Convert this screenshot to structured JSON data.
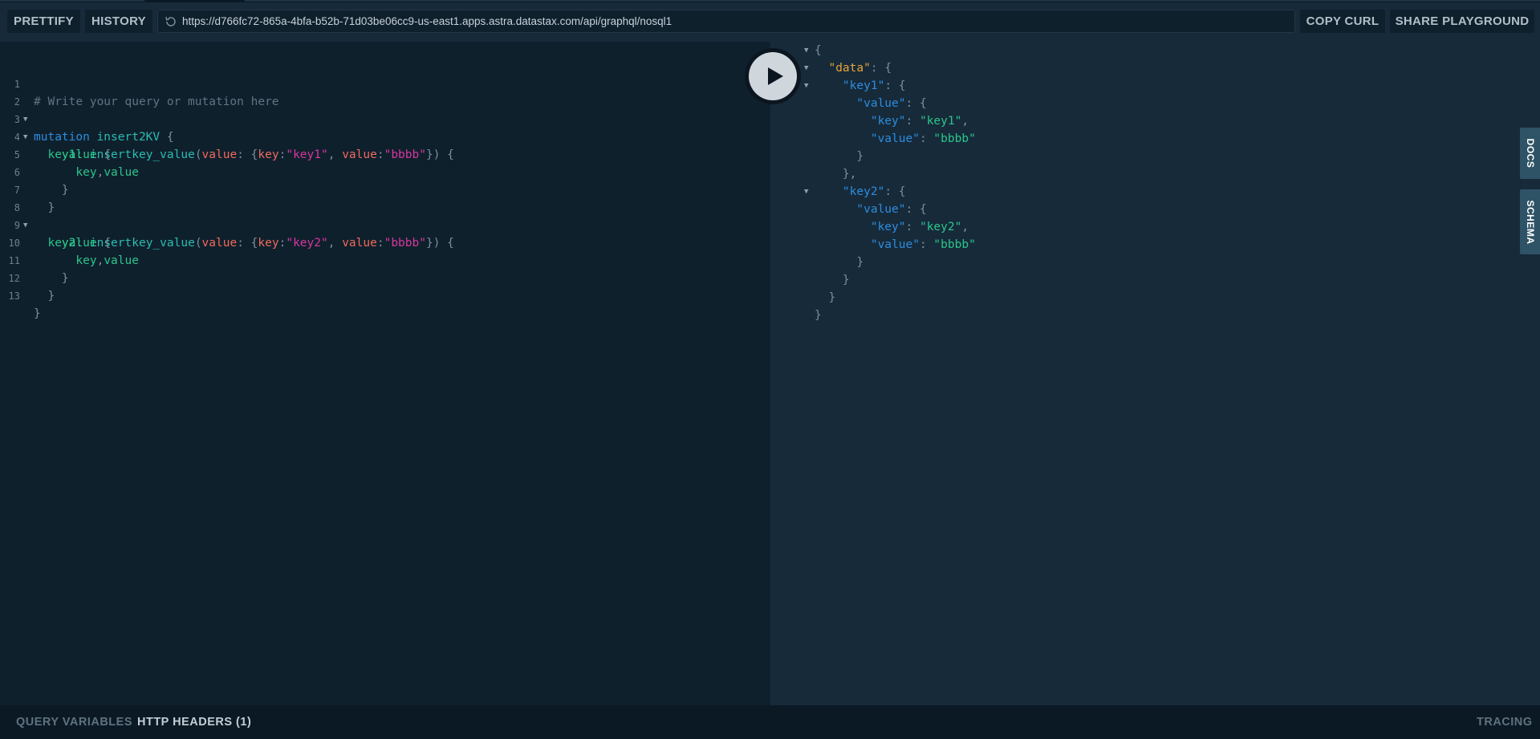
{
  "toolbar": {
    "prettify": "PRETTIFY",
    "history": "HISTORY",
    "url": "https://d766fc72-865a-4bfa-b52b-71d03be06cc9-us-east1.apps.astra.datastax.com/api/graphql/nosql1",
    "copy_curl": "COPY CURL",
    "share": "SHARE PLAYGROUND"
  },
  "editor": {
    "line_numbers": [
      "1",
      "2",
      "3",
      "4",
      "5",
      "6",
      "7",
      "8",
      "9",
      "10",
      "11",
      "12",
      "13"
    ],
    "l1": {
      "comment": "# Write your query or mutation here"
    },
    "l2": {
      "kw": "mutation",
      "name": "insert2KV",
      "brace": "{"
    },
    "l3": {
      "alias": "key1",
      "colon": ":",
      "fn": "insertkey_value",
      "open": "(",
      "arg": "value",
      "argcolon": ":",
      "ob": "{",
      "k": "key",
      "kc": ":",
      "kv": "\"key1\"",
      "comma": ",",
      "v": "value",
      "vc": ":",
      "vv": "\"bbbb\"",
      "close": "}) {"
    },
    "l4": {
      "field": "value",
      "brace": "{"
    },
    "l5": {
      "f1": "key",
      "comma": ",",
      "f2": "value"
    },
    "l6": {
      "brace": "}"
    },
    "l7": {
      "brace": "}"
    },
    "l8": {
      "alias": "key2",
      "colon": ":",
      "fn": "insertkey_value",
      "open": "(",
      "arg": "value",
      "argcolon": ":",
      "ob": "{",
      "k": "key",
      "kc": ":",
      "kv": "\"key2\"",
      "comma": ",",
      "v": "value",
      "vc": ":",
      "vv": "\"bbbb\"",
      "close": "}) {"
    },
    "l9": {
      "field": "value",
      "brace": "{"
    },
    "l10": {
      "f1": "key",
      "comma": ",",
      "f2": "value"
    },
    "l11": {
      "brace": "}"
    },
    "l12": {
      "brace": "}"
    },
    "l13": {
      "brace": "}"
    }
  },
  "result": {
    "r1": "{",
    "r2": {
      "key": "\"data\"",
      "rest": ": {"
    },
    "r3": {
      "key": "\"key1\"",
      "rest": ": {"
    },
    "r4": {
      "key": "\"value\"",
      "rest": ": {"
    },
    "r5": {
      "key": "\"key\"",
      "sep": ": ",
      "val": "\"key1\"",
      "comma": ","
    },
    "r6": {
      "key": "\"value\"",
      "sep": ": ",
      "val": "\"bbbb\""
    },
    "r7": "}",
    "r8": "},",
    "r9": {
      "key": "\"key2\"",
      "rest": ": {"
    },
    "r10": {
      "key": "\"value\"",
      "rest": ": {"
    },
    "r11": {
      "key": "\"key\"",
      "sep": ": ",
      "val": "\"key2\"",
      "comma": ","
    },
    "r12": {
      "key": "\"value\"",
      "sep": ": ",
      "val": "\"bbbb\""
    },
    "r13": "}",
    "r14": "}",
    "r15": "}",
    "r16": "}"
  },
  "side_tabs": {
    "docs": "DOCS",
    "schema": "SCHEMA"
  },
  "bottom": {
    "query_variables": "QUERY VARIABLES",
    "http_headers": "HTTP HEADERS (1)",
    "tracing": "TRACING"
  },
  "colors": {
    "accent": "#2f5366",
    "background": "#0f202d",
    "panel": "#172a3a"
  }
}
